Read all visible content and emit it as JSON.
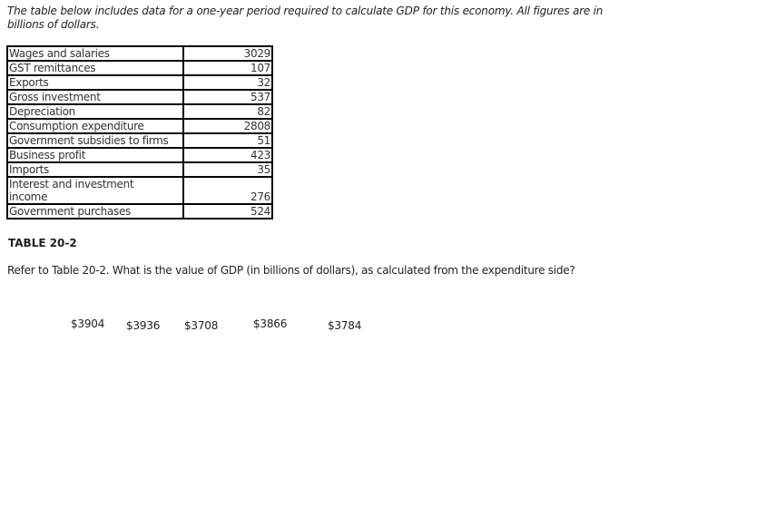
{
  "intro_text": "The table below includes data for a one-year period required to calculate GDP for this economy. All figures are in billions of dollars.",
  "table": {
    "rows": [
      {
        "label": "Wages and salaries",
        "value": "3029"
      },
      {
        "label": "GST remittances",
        "value": "107"
      },
      {
        "label": "Exports",
        "value": "32"
      },
      {
        "label": "Gross investment",
        "value": "537"
      },
      {
        "label": "Depreciation",
        "value": "82"
      },
      {
        "label": "Consumption expenditure",
        "value": "2808"
      },
      {
        "label": "Government subsidies to firms",
        "value": "51"
      },
      {
        "label": "Business profit",
        "value": "423"
      },
      {
        "label": "Imports",
        "value": "35"
      },
      {
        "label": "Interest and investment income",
        "value": "276"
      },
      {
        "label": "Government purchases",
        "value": "524"
      }
    ],
    "caption": "TABLE 20-2"
  },
  "question": "Refer to Table 20-2. What is the value of GDP (in billions of dollars), as calculated from the expenditure side?",
  "options": [
    "$3904",
    "$3936",
    "$3708",
    "$3866",
    "$3784"
  ]
}
